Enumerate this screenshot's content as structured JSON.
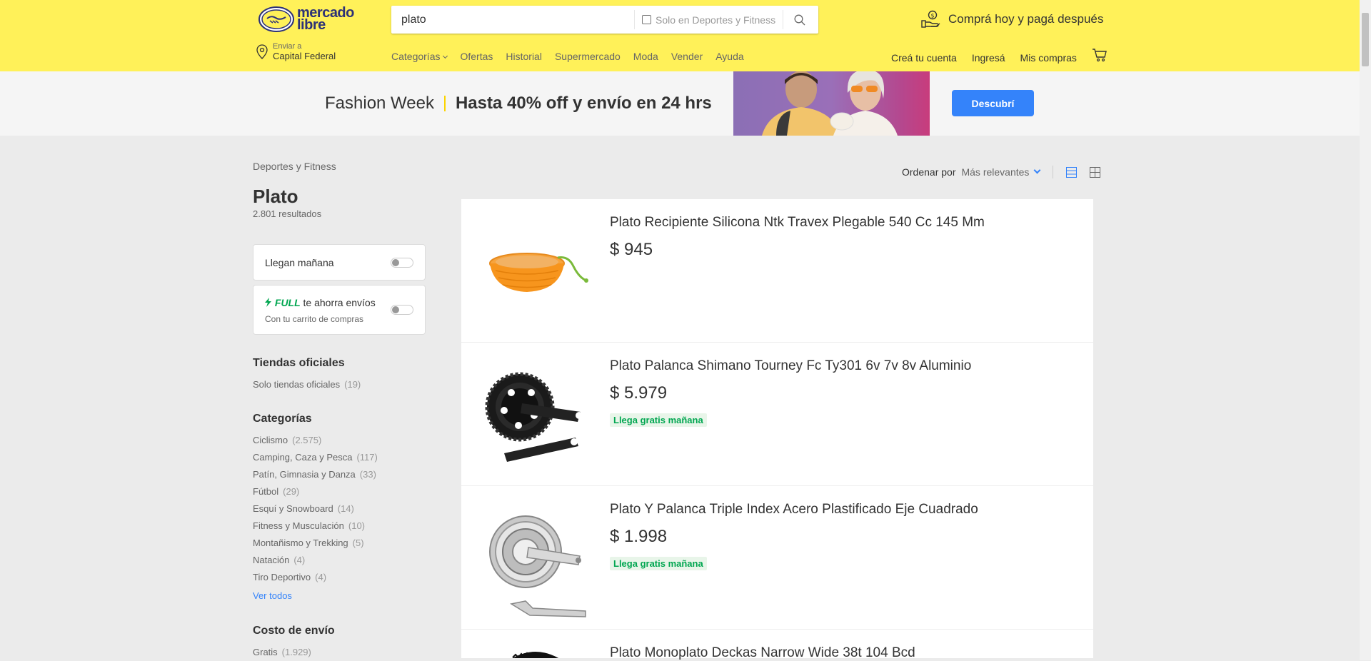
{
  "header": {
    "logo_line1": "mercado",
    "logo_line2": "libre",
    "search_value": "plato",
    "search_filter_label": "Solo en Deportes y Fitness",
    "promo_text": "Comprá hoy y pagá después",
    "location_small": "Enviar a",
    "location_big": "Capital Federal",
    "nav": [
      "Categorías",
      "Ofertas",
      "Historial",
      "Supermercado",
      "Moda",
      "Vender",
      "Ayuda"
    ],
    "account": [
      "Creá tu cuenta",
      "Ingresá",
      "Mis compras"
    ]
  },
  "banner": {
    "event": "Fashion Week",
    "headline": "Hasta 40% off y envío en 24 hrs",
    "button": "Descubrí"
  },
  "sidebar": {
    "breadcrumb": "Deportes y Fitness",
    "title": "Plato",
    "results": "2.801 resultados",
    "filter_llegan": "Llegan mañana",
    "full_tag": "FULL",
    "full_label": "te ahorra envíos",
    "full_sub": "Con tu carrito de compras",
    "tiendas_title": "Tiendas oficiales",
    "tiendas_item": {
      "label": "Solo tiendas oficiales",
      "count": "(19)"
    },
    "categorias_title": "Categorías",
    "categorias": [
      {
        "label": "Ciclismo",
        "count": "(2.575)"
      },
      {
        "label": "Camping, Caza y Pesca",
        "count": "(117)"
      },
      {
        "label": "Patín, Gimnasia y Danza",
        "count": "(33)"
      },
      {
        "label": "Fútbol",
        "count": "(29)"
      },
      {
        "label": "Esquí y Snowboard",
        "count": "(14)"
      },
      {
        "label": "Fitness y Musculación",
        "count": "(10)"
      },
      {
        "label": "Montañismo y Trekking",
        "count": "(5)"
      },
      {
        "label": "Natación",
        "count": "(4)"
      },
      {
        "label": "Tiro Deportivo",
        "count": "(4)"
      }
    ],
    "ver_todos": "Ver todos",
    "envio_title": "Costo de envío",
    "envio_item": {
      "label": "Gratis",
      "count": "(1.929)"
    }
  },
  "sort": {
    "label": "Ordenar por",
    "value": "Más relevantes"
  },
  "items": [
    {
      "title": "Plato Recipiente Silicona Ntk Travex Plegable 540 Cc 145 Mm",
      "price": "$ 945",
      "shipping": ""
    },
    {
      "title": "Plato Palanca Shimano Tourney Fc Ty301 6v 7v 8v Aluminio",
      "price": "$ 5.979",
      "shipping": "Llega gratis mañana"
    },
    {
      "title": "Plato Y Palanca Triple Index Acero Plastificado Eje Cuadrado",
      "price": "$ 1.998",
      "shipping": "Llega gratis mañana"
    },
    {
      "title": "Plato Monoplato Deckas Narrow Wide 38t 104 Bcd",
      "price": "",
      "shipping": ""
    }
  ]
}
